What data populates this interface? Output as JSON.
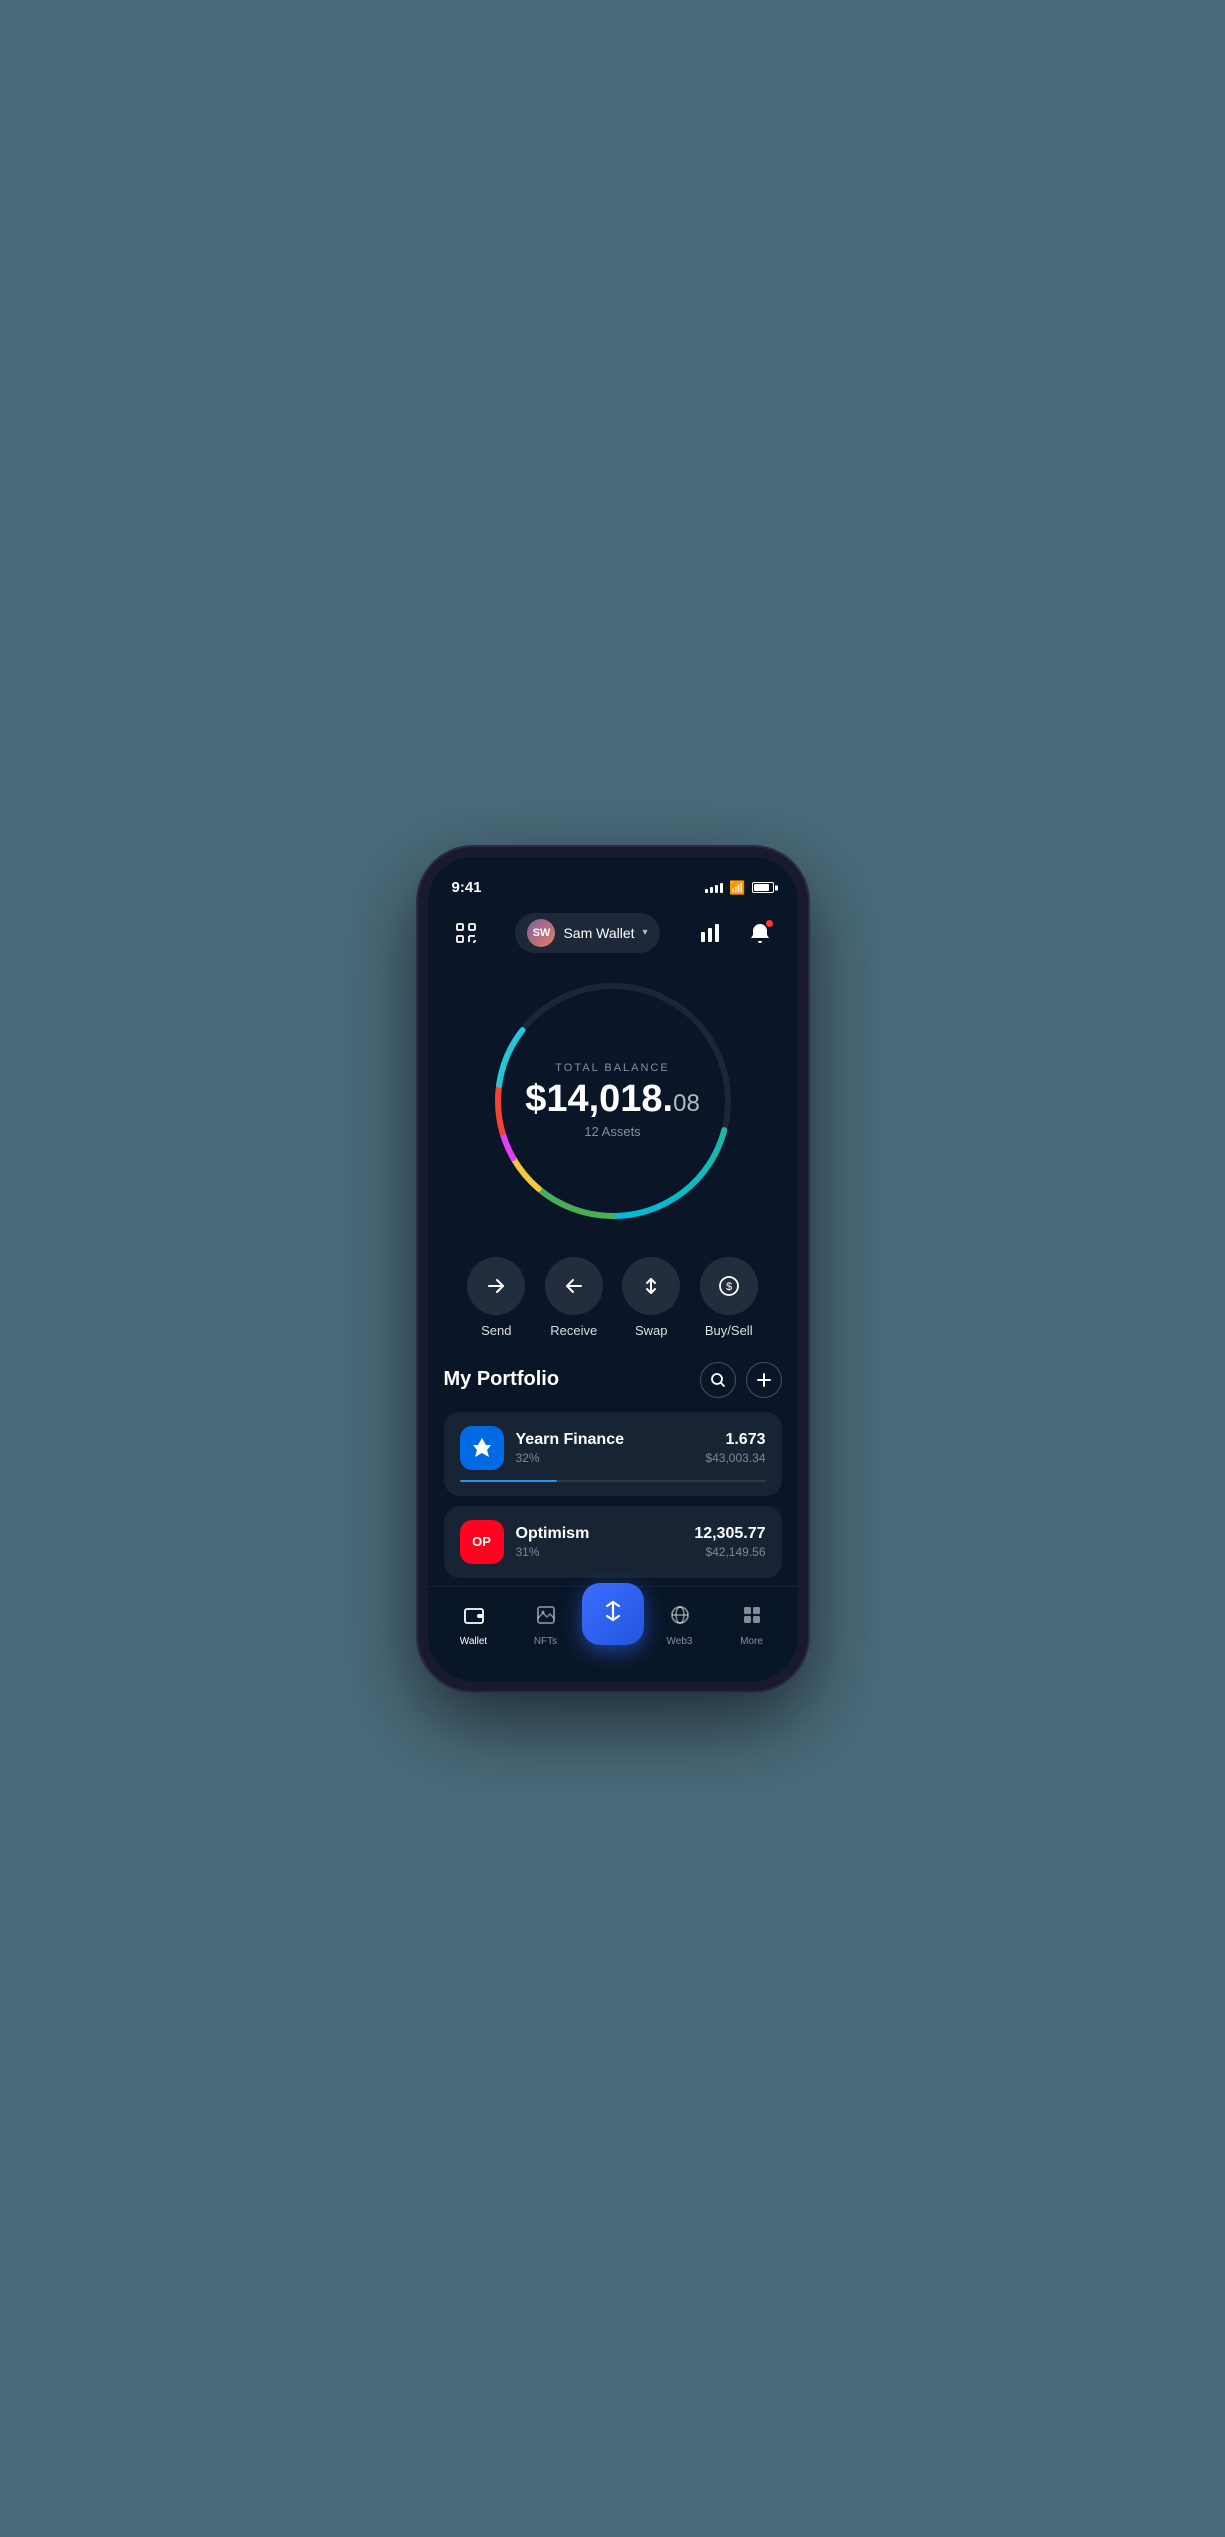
{
  "statusBar": {
    "time": "9:41"
  },
  "header": {
    "walletName": "Sam Wallet",
    "avatarInitials": "SW",
    "scanIconLabel": "scan-icon",
    "chartIconLabel": "chart-icon",
    "bellIconLabel": "bell-icon"
  },
  "balance": {
    "label": "TOTAL BALANCE",
    "whole": "$14,018.",
    "cents": "08",
    "assets": "12 Assets"
  },
  "actions": [
    {
      "id": "send",
      "label": "Send",
      "icon": "→"
    },
    {
      "id": "receive",
      "label": "Receive",
      "icon": "←"
    },
    {
      "id": "swap",
      "label": "Swap",
      "icon": "⇅"
    },
    {
      "id": "buysell",
      "label": "Buy/Sell",
      "icon": "$"
    }
  ],
  "portfolio": {
    "title": "My Portfolio",
    "searchLabel": "search",
    "addLabel": "add",
    "assets": [
      {
        "id": "yearn",
        "name": "Yearn Finance",
        "percentage": "32%",
        "amount": "1.673",
        "usdValue": "$43,003.34",
        "progressColor": "#2196f3",
        "progressWidth": "32"
      },
      {
        "id": "optimism",
        "name": "Optimism",
        "percentage": "31%",
        "amount": "12,305.77",
        "usdValue": "$42,149.56",
        "progressColor": "#ff0420",
        "progressWidth": "31"
      }
    ]
  },
  "bottomNav": {
    "items": [
      {
        "id": "wallet",
        "label": "Wallet",
        "active": true
      },
      {
        "id": "nfts",
        "label": "NFTs",
        "active": false
      },
      {
        "id": "web3",
        "label": "Web3",
        "active": false
      },
      {
        "id": "more",
        "label": "More",
        "active": false
      }
    ],
    "centerLabel": "swap-center"
  }
}
